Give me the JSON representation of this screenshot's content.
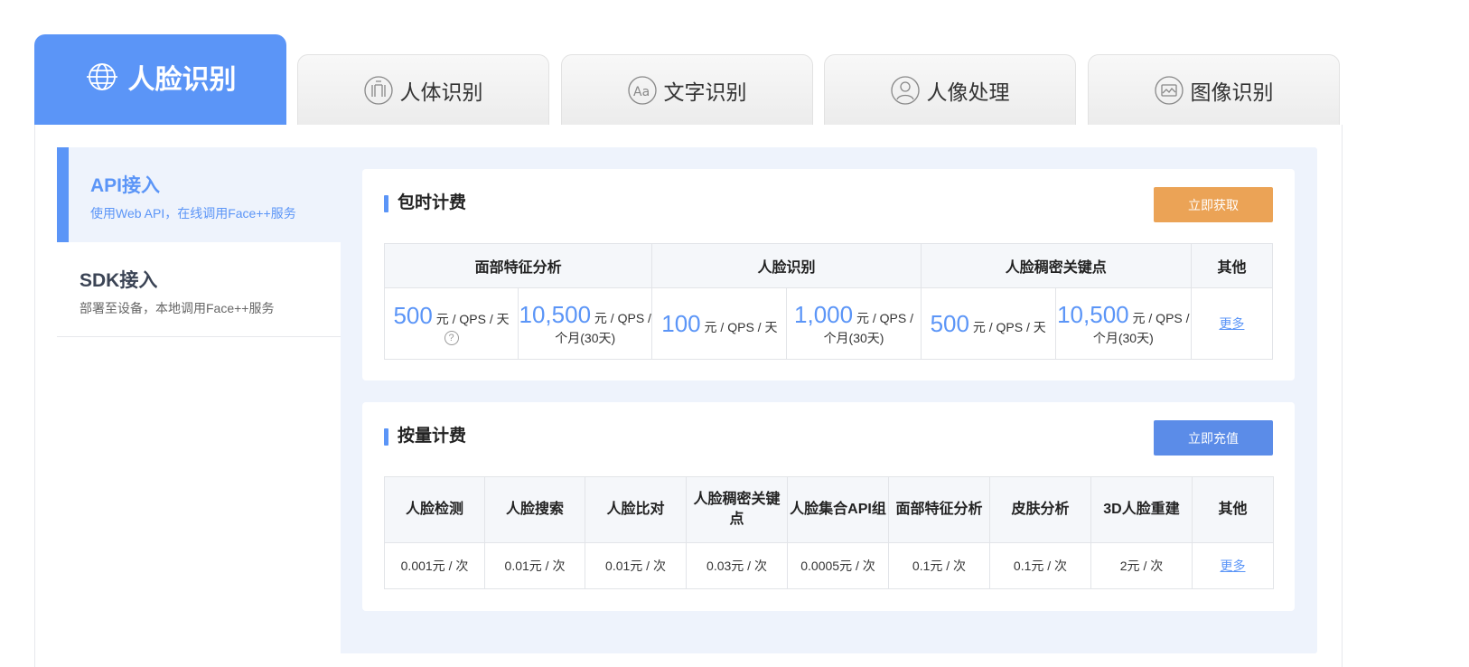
{
  "tabs": [
    {
      "label": "人脸识别",
      "icon": "globe-icon",
      "active": true
    },
    {
      "label": "人体识别",
      "icon": "body-icon",
      "active": false
    },
    {
      "label": "文字识别",
      "icon": "text-aa-icon",
      "active": false
    },
    {
      "label": "人像处理",
      "icon": "portrait-icon",
      "active": false
    },
    {
      "label": "图像识别",
      "icon": "image-icon",
      "active": false
    }
  ],
  "sidebar": {
    "items": [
      {
        "title": "API接入",
        "desc": "使用Web API，在线调用Face++服务",
        "active": true
      },
      {
        "title": "SDK接入",
        "desc": "部署至设备，本地调用Face++服务",
        "active": false
      }
    ]
  },
  "hourly": {
    "title": "包时计费",
    "button": "立即获取",
    "headers": [
      "面部特征分析",
      "人脸识别",
      "人脸稠密关键点",
      "其他"
    ],
    "cells": [
      {
        "value": "500",
        "unit": "元 / QPS / 天"
      },
      {
        "value": "10,500",
        "unit": "元 / QPS / 个月(30天)"
      },
      {
        "value": "100",
        "unit": "元 / QPS / 天"
      },
      {
        "value": "1,000",
        "unit": "元 / QPS / 个月(30天)"
      },
      {
        "value": "500",
        "unit": "元 / QPS / 天"
      },
      {
        "value": "10,500",
        "unit": "元 / QPS / 个月(30天)"
      }
    ],
    "help": "?",
    "more": "更多"
  },
  "usage": {
    "title": "按量计费",
    "button": "立即充值",
    "headers": [
      "人脸检测",
      "人脸搜索",
      "人脸比对",
      "人脸稠密关键点",
      "人脸集合API组",
      "面部特征分析",
      "皮肤分析",
      "3D人脸重建",
      "其他"
    ],
    "prices": [
      "0.001元 / 次",
      "0.01元 / 次",
      "0.01元 / 次",
      "0.03元 / 次",
      "0.0005元 / 次",
      "0.1元 / 次",
      "0.1元 / 次",
      "2元 / 次"
    ],
    "more": "更多"
  },
  "colors": {
    "accent": "#5b95f7",
    "orange": "#eba356",
    "blue_button": "#5b8ce8"
  }
}
